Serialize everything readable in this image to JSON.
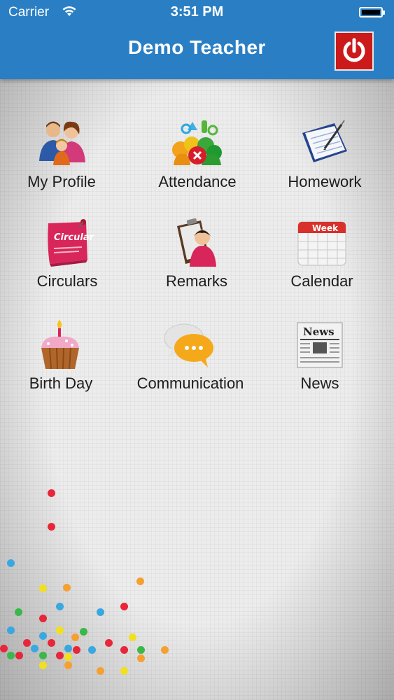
{
  "status_bar": {
    "carrier": "Carrier",
    "time": "3:51 PM"
  },
  "header": {
    "title": "Demo Teacher",
    "power_icon": "power-icon",
    "accent_color": "#2a7fc4",
    "power_color": "#cc1a1a"
  },
  "menu": {
    "items": [
      {
        "label": "My Profile",
        "icon": "profile-family-icon"
      },
      {
        "label": "Attendance",
        "icon": "attendance-icon"
      },
      {
        "label": "Homework",
        "icon": "homework-notebook-icon"
      },
      {
        "label": "Circulars",
        "icon": "circular-note-icon"
      },
      {
        "label": "Remarks",
        "icon": "remarks-clipboard-icon"
      },
      {
        "label": "Calendar",
        "icon": "calendar-week-icon"
      },
      {
        "label": "Birth Day",
        "icon": "birthday-cupcake-icon"
      },
      {
        "label": "Communication",
        "icon": "chat-bubbles-icon"
      },
      {
        "label": "News",
        "icon": "newspaper-icon"
      }
    ],
    "icon_texts": {
      "circular": "Circular",
      "calendar": "Week",
      "news": "News"
    }
  }
}
